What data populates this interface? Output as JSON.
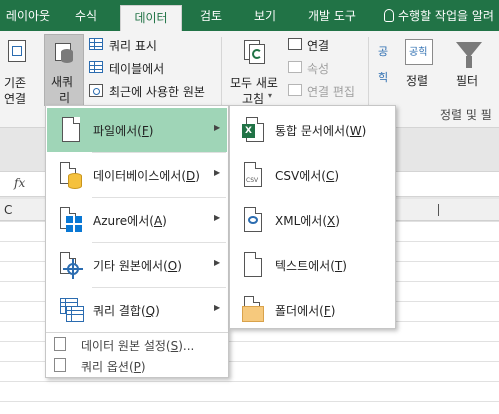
{
  "tabs": [
    {
      "label": "레이아웃",
      "active": false
    },
    {
      "label": "수식",
      "active": false
    },
    {
      "label": "데이터",
      "active": true
    },
    {
      "label": "검토",
      "active": false
    },
    {
      "label": "보기",
      "active": false
    },
    {
      "label": "개발 도구",
      "active": false
    }
  ],
  "tell_me": "수행할 작업을 알려",
  "ribbon": {
    "existing_connections": [
      "기존",
      "연결"
    ],
    "new_query": [
      "새쿼",
      "리"
    ],
    "show_queries": "쿼리 표시",
    "from_table": "테이블에서",
    "recent_sources": "최근에 사용한 원본",
    "refresh_all": [
      "모두 새로",
      "고침"
    ],
    "connections": "연결",
    "properties": "속성",
    "edit_links": "연결 편집",
    "sort_label": "정렬",
    "filter_label": "필터",
    "group_label": "정렬 및 필",
    "sort_az_top": "공",
    "sort_az_bottom": "힉"
  },
  "formula_bar": {
    "fx": "fx"
  },
  "column_header": {
    "c": "C"
  },
  "menu_primary": {
    "items": [
      {
        "label": "파일에서",
        "key": "F",
        "icon": "file-icon",
        "highlighted": true
      },
      {
        "label": "데이터베이스에서",
        "key": "D",
        "icon": "database-icon",
        "highlighted": false
      },
      {
        "label": "Azure에서",
        "key": "A",
        "icon": "azure-icon",
        "highlighted": false
      },
      {
        "label": "기타 원본에서",
        "key": "O",
        "icon": "other-sources-icon",
        "highlighted": false
      },
      {
        "label": "쿼리 결합",
        "key": "Q",
        "icon": "combine-queries-icon",
        "highlighted": false
      }
    ],
    "footer": [
      {
        "label": "데이터 원본 설정",
        "key": "S",
        "suffix": "...",
        "icon": "data-source-settings-icon"
      },
      {
        "label": "쿼리 옵션",
        "key": "P",
        "suffix": "",
        "icon": "query-options-icon"
      }
    ]
  },
  "menu_file": {
    "items": [
      {
        "label": "통합 문서에서",
        "key": "W",
        "icon": "excel-workbook-icon",
        "badge": "X"
      },
      {
        "label": "CSV에서",
        "key": "C",
        "icon": "csv-file-icon",
        "badge": "CSV"
      },
      {
        "label": "XML에서",
        "key": "X",
        "icon": "xml-file-icon",
        "badge": ""
      },
      {
        "label": "텍스트에서",
        "key": "T",
        "icon": "text-file-icon",
        "badge": ""
      },
      {
        "label": "폴더에서",
        "key": "F",
        "icon": "folder-icon",
        "badge": ""
      }
    ]
  },
  "colors": {
    "accent": "#217346",
    "highlight": "#9fd5b7",
    "database": "#f5c13d",
    "azure": "#0a78d4",
    "folder": "#f6c97d"
  }
}
